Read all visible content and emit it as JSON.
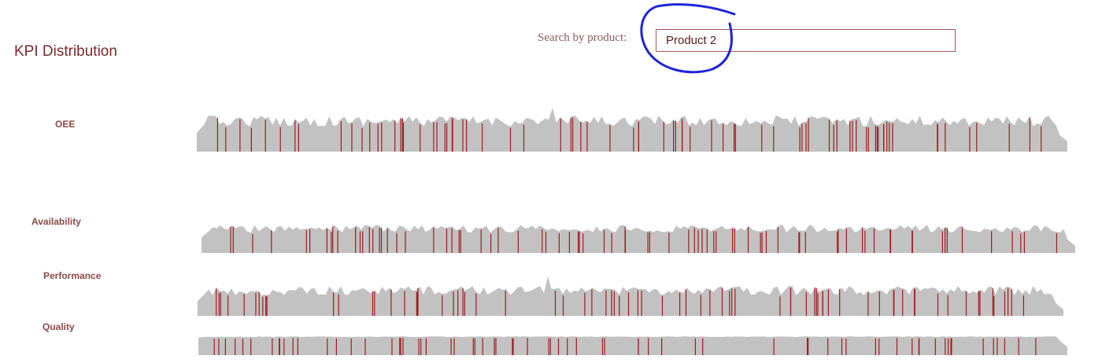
{
  "page": {
    "title": "KPI Distribution"
  },
  "search": {
    "label": "Search by product:",
    "value": "Product 2"
  },
  "colors": {
    "area_fill": "#c2c2c2",
    "highlight_marker": "#a01c1c",
    "annotation_circle": "#1f25d6"
  },
  "kpis": [
    {
      "key": "oee",
      "label": "OEE"
    },
    {
      "key": "availability",
      "label": "Availability"
    },
    {
      "key": "performance",
      "label": "Performance"
    },
    {
      "key": "quality",
      "label": "Quality"
    }
  ]
}
